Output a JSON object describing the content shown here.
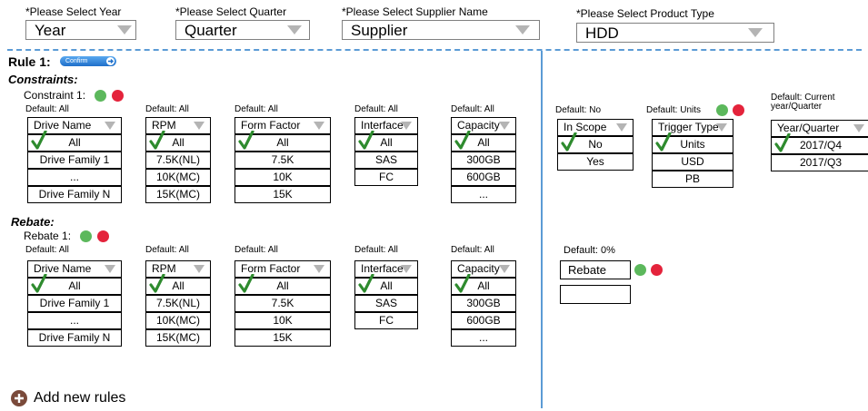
{
  "filters": {
    "year": {
      "label": "*Please Select Year",
      "value": "Year"
    },
    "quarter": {
      "label": "*Please Select Quarter",
      "value": "Quarter"
    },
    "supplier": {
      "label": "*Please Select Supplier Name",
      "value": "Supplier"
    },
    "product": {
      "label": "*Please Select Product Type",
      "value": "HDD"
    }
  },
  "rule": {
    "title": "Rule 1:",
    "confirm_label": "Confirm",
    "constraints_title": "Constraints:",
    "constraint_item": "Constraint 1:",
    "rebate_title": "Rebate:",
    "rebate_item": "Rebate 1:"
  },
  "constraint_columns": [
    {
      "default": "Default: All",
      "header": "Drive Name",
      "rows": [
        "All",
        "Drive Family 1",
        "...",
        "Drive Family N"
      ]
    },
    {
      "default": "Default: All",
      "header": "RPM",
      "rows": [
        "All",
        "7.5K(NL)",
        "10K(MC)",
        "15K(MC)"
      ]
    },
    {
      "default": "Default: All",
      "header": "Form Factor",
      "rows": [
        "All",
        "7.5K",
        "10K",
        "15K"
      ]
    },
    {
      "default": "Default: All",
      "header": "Interface",
      "rows": [
        "All",
        "SAS",
        "FC"
      ]
    },
    {
      "default": "Default: All",
      "header": "Capacity",
      "rows": [
        "All",
        "300GB",
        "600GB",
        "..."
      ]
    }
  ],
  "right_columns": [
    {
      "default": "Default: No",
      "header": "In Scope",
      "rows": [
        "No",
        "Yes"
      ]
    },
    {
      "default": "Default: Units",
      "header": "Trigger Type",
      "rows": [
        "Units",
        "USD",
        "PB"
      ]
    },
    {
      "default_line1": "Default: Current",
      "default_line2": "year/Quarter",
      "header": "Year/Quarter",
      "rows": [
        "2017/Q4",
        "2017/Q3"
      ]
    }
  ],
  "rebate_columns": [
    {
      "default": "Default: All",
      "header": "Drive Name",
      "rows": [
        "All",
        "Drive Family 1",
        "...",
        "Drive Family N"
      ]
    },
    {
      "default": "Default: All",
      "header": "RPM",
      "rows": [
        "All",
        "7.5K(NL)",
        "10K(MC)",
        "15K(MC)"
      ]
    },
    {
      "default": "Default: All",
      "header": "Form Factor",
      "rows": [
        "All",
        "7.5K",
        "10K",
        "15K"
      ]
    },
    {
      "default": "Default: All",
      "header": "Interface",
      "rows": [
        "All",
        "SAS",
        "FC"
      ]
    },
    {
      "default": "Default: All",
      "header": "Capacity",
      "rows": [
        "All",
        "300GB",
        "600GB",
        "..."
      ]
    }
  ],
  "rebate_amount": {
    "default": "Default: 0%",
    "label": "Rebate",
    "value": ""
  },
  "add_rules_label": "Add new rules",
  "colors": {
    "divider": "#5b9bd5",
    "plus": "#5cb85c",
    "minus": "#e4233b",
    "check": "#2e8b2e",
    "confirm": "#1f6fc9",
    "add_icon": "#7a4a3a"
  },
  "icons": [
    "plus-circle-icon",
    "minus-circle-icon",
    "checkmark-icon",
    "chevron-down-icon",
    "arrow-right-icon"
  ]
}
